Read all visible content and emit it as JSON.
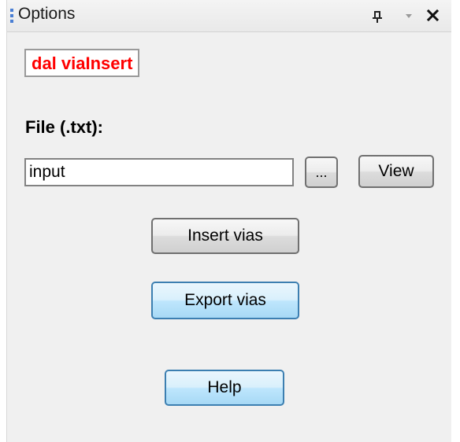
{
  "panel": {
    "title": "Options",
    "icons": {
      "grip": "grip-icon",
      "pin": "pin-icon",
      "dropdown": "dropdown-arrow-icon",
      "close": "close-icon"
    },
    "accent_color": "#4a7fd4"
  },
  "header_label": {
    "text": "dal viaInsert",
    "color": "#ff0000"
  },
  "file": {
    "label": "File (.txt):",
    "value": "input",
    "browse_label": "...",
    "view_label": "View"
  },
  "actions": {
    "insert_label": "Insert vias",
    "export_label": "Export vias",
    "help_label": "Help"
  }
}
